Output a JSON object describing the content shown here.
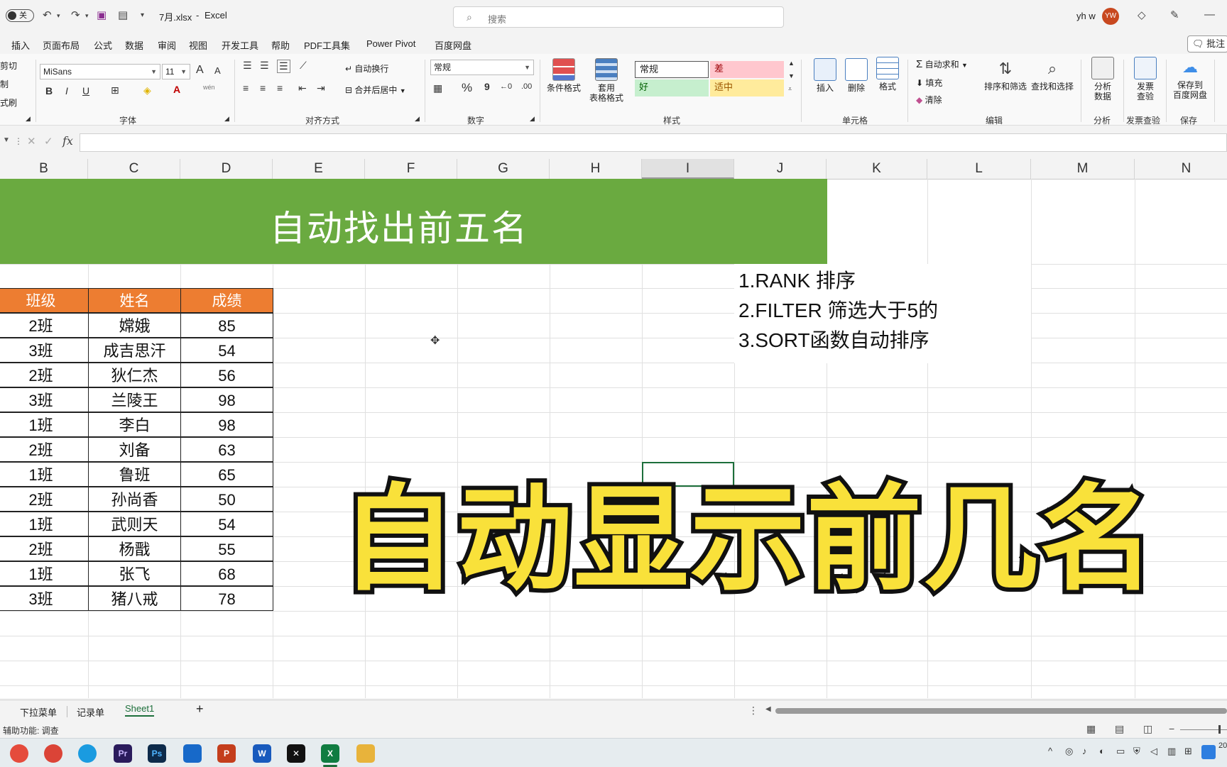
{
  "titlebar": {
    "toggle_label": "关",
    "filename": "7月.xlsx",
    "separator": "-",
    "app_name": "Excel",
    "search_placeholder": "搜索",
    "user_name": "yh w",
    "avatar_initials": "YW",
    "minimize_glyph": "—"
  },
  "menu": {
    "items": [
      "插入",
      "页面布局",
      "公式",
      "数据",
      "审阅",
      "视图",
      "开发工具",
      "帮助",
      "PDF工具集",
      "Power Pivot",
      "百度网盘"
    ],
    "comment_label": "批注"
  },
  "ribbon": {
    "clipboard": {
      "cut": "剪切",
      "copy": "复制",
      "format_painter": "格式刷"
    },
    "font": {
      "name": "MiSans",
      "size": "11",
      "label": "字体",
      "bold": "B",
      "italic": "I",
      "underline": "U",
      "grow": "A",
      "shrink": "A",
      "color_glyph": "A",
      "phonetic": "wén"
    },
    "alignment": {
      "wrap": "自动换行",
      "merge": "合并后居中",
      "label": "对齐方式"
    },
    "number": {
      "format": "常规",
      "percent": "%",
      "comma": "9",
      "label": "数字"
    },
    "styles": {
      "conditional": [
        "条件格式"
      ],
      "table": [
        "套用",
        "表格格式"
      ],
      "normal": "常规",
      "bad": "差",
      "good": "好",
      "neutral": "适中",
      "label": "样式",
      "colors": {
        "bad_bg": "#ffc7ce",
        "bad_fg": "#9c0006",
        "good_bg": "#c6efce",
        "good_fg": "#006100",
        "neutral_bg": "#ffeb9c",
        "neutral_fg": "#9c5700"
      }
    },
    "cells": {
      "insert": "插入",
      "delete": "删除",
      "format": "格式",
      "label": "单元格"
    },
    "editing": {
      "autosum": "自动求和",
      "fill": "填充",
      "clear": "清除",
      "sort_filter": "排序和筛选",
      "find_select": "查找和选择",
      "label": "编辑"
    },
    "analysis": {
      "analyze": [
        "分析",
        "数据"
      ],
      "label": "分析"
    },
    "invoice": {
      "check": [
        "发票",
        "查验"
      ],
      "label": "发票查验"
    },
    "save": {
      "baidu": [
        "保存到",
        "百度网盘"
      ],
      "label": "保存"
    }
  },
  "formula_bar": {
    "fx": "fx",
    "cancel": "✕",
    "enter": "✓"
  },
  "columns": [
    "B",
    "C",
    "D",
    "E",
    "F",
    "G",
    "H",
    "I",
    "J",
    "K",
    "L",
    "M",
    "N"
  ],
  "selected_column": "I",
  "sheet": {
    "banner_title": "自动找出前五名",
    "banner_color": "#6aaa40",
    "header_color": "#ed7d31",
    "headers": [
      "班级",
      "姓名",
      "成绩"
    ],
    "rows": [
      [
        "2班",
        "嫦娥",
        "85"
      ],
      [
        "3班",
        "成吉思汗",
        "54"
      ],
      [
        "2班",
        "狄仁杰",
        "56"
      ],
      [
        "3班",
        "兰陵王",
        "98"
      ],
      [
        "1班",
        "李白",
        "98"
      ],
      [
        "2班",
        "刘备",
        "63"
      ],
      [
        "1班",
        "鲁班",
        "65"
      ],
      [
        "2班",
        "孙尚香",
        "50"
      ],
      [
        "1班",
        "武则天",
        "54"
      ],
      [
        "2班",
        "杨戬",
        "55"
      ],
      [
        "1班",
        "张飞",
        "68"
      ],
      [
        "3班",
        "猪八戒",
        "78"
      ]
    ],
    "notes": [
      "1.RANK   排序",
      "2.FILTER   筛选大于5的",
      "3.SORT函数自动排序"
    ]
  },
  "overlay_caption": "自动显示前几名",
  "tabs": {
    "items": [
      "下拉菜单",
      "记录单",
      "Sheet1"
    ],
    "active": "Sheet1",
    "add": "+"
  },
  "status": {
    "accessibility": "辅助功能: 调查"
  },
  "taskbar": {
    "apps": [
      {
        "name": "chrome",
        "label": "",
        "color": "#db4437"
      },
      {
        "name": "edge",
        "label": "",
        "color": "#1a9be0"
      },
      {
        "name": "premiere",
        "label": "Pr",
        "color": "#2a1b5c"
      },
      {
        "name": "photoshop",
        "label": "Ps",
        "color": "#0d2a4a"
      },
      {
        "name": "meeting",
        "label": "",
        "color": "#1769c9"
      },
      {
        "name": "powerpoint",
        "label": "P",
        "color": "#c43e1c"
      },
      {
        "name": "word",
        "label": "W",
        "color": "#185abd"
      },
      {
        "name": "capcut",
        "label": "✕",
        "color": "#111111"
      },
      {
        "name": "excel",
        "label": "X",
        "color": "#107c41"
      },
      {
        "name": "explorer",
        "label": "",
        "color": "#e8b33b"
      }
    ],
    "clock_partial": "20"
  }
}
